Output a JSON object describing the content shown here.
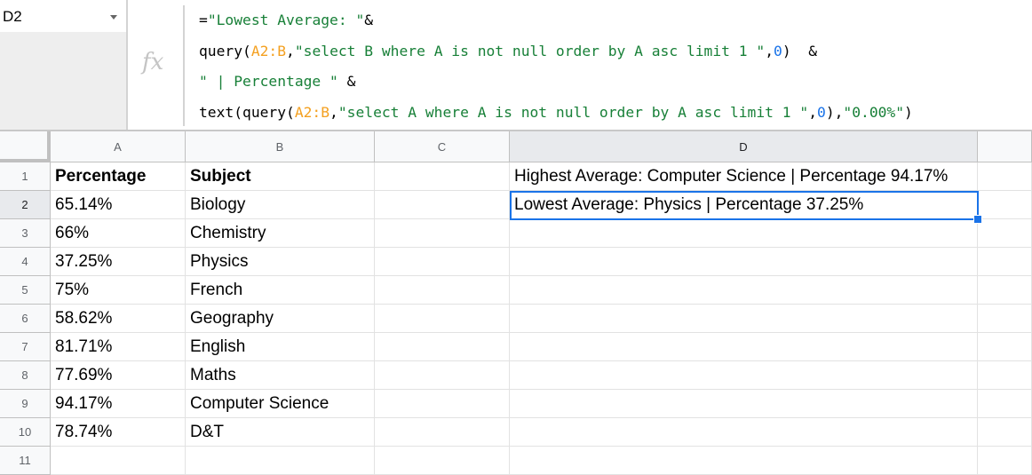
{
  "namebox": {
    "value": "D2",
    "dropdown_icon": "triangle-down"
  },
  "formula_bar": {
    "fx_label": "fx",
    "lines": [
      [
        {
          "t": "=",
          "c": "plain"
        },
        {
          "t": "\"Lowest Average: \"",
          "c": "str"
        },
        {
          "t": "&",
          "c": "plain"
        }
      ],
      [
        {
          "t": "query(",
          "c": "plain"
        },
        {
          "t": "A2:B",
          "c": "ref"
        },
        {
          "t": ",",
          "c": "plain"
        },
        {
          "t": "\"select B where A is not null order by A asc limit 1 \"",
          "c": "str"
        },
        {
          "t": ",",
          "c": "plain"
        },
        {
          "t": "0",
          "c": "num"
        },
        {
          "t": ")  &",
          "c": "plain"
        }
      ],
      [
        {
          "t": "\" | Percentage \"",
          "c": "str"
        },
        {
          "t": " &",
          "c": "plain"
        }
      ],
      [
        {
          "t": "text(query(",
          "c": "plain"
        },
        {
          "t": "A2:B",
          "c": "ref"
        },
        {
          "t": ",",
          "c": "plain"
        },
        {
          "t": "\"select A where A is not null order by A asc limit 1 \"",
          "c": "str"
        },
        {
          "t": ",",
          "c": "plain"
        },
        {
          "t": "0",
          "c": "num"
        },
        {
          "t": "),",
          "c": "plain"
        },
        {
          "t": "\"0.00%\"",
          "c": "str"
        },
        {
          "t": ")",
          "c": "plain"
        }
      ]
    ]
  },
  "columns": [
    "A",
    "B",
    "C",
    "D",
    ""
  ],
  "selected_column": "D",
  "selected_row": 2,
  "rows": [
    {
      "n": "1",
      "A": "Percentage",
      "B": "Subject",
      "C": "",
      "D": "Highest Average: Computer Science | Percentage 94.17%",
      "bold": true
    },
    {
      "n": "2",
      "A": "65.14%",
      "B": "Biology",
      "C": "",
      "D": "Lowest Average: Physics | Percentage 37.25%"
    },
    {
      "n": "3",
      "A": "66%",
      "B": "Chemistry",
      "C": "",
      "D": ""
    },
    {
      "n": "4",
      "A": "37.25%",
      "B": "Physics",
      "C": "",
      "D": ""
    },
    {
      "n": "5",
      "A": "75%",
      "B": "French",
      "C": "",
      "D": ""
    },
    {
      "n": "6",
      "A": "58.62%",
      "B": "Geography",
      "C": "",
      "D": ""
    },
    {
      "n": "7",
      "A": "81.71%",
      "B": "English",
      "C": "",
      "D": ""
    },
    {
      "n": "8",
      "A": "77.69%",
      "B": "Maths",
      "C": "",
      "D": ""
    },
    {
      "n": "9",
      "A": "94.17%",
      "B": "Computer Science",
      "C": "",
      "D": ""
    },
    {
      "n": "10",
      "A": "78.74%",
      "B": "D&T",
      "C": "",
      "D": ""
    },
    {
      "n": "11",
      "A": "",
      "B": "",
      "C": "",
      "D": ""
    }
  ],
  "colors": {
    "selection": "#1a73e8",
    "string": "#188038",
    "range_ref": "#f4a020",
    "number": "#1a73e8"
  }
}
